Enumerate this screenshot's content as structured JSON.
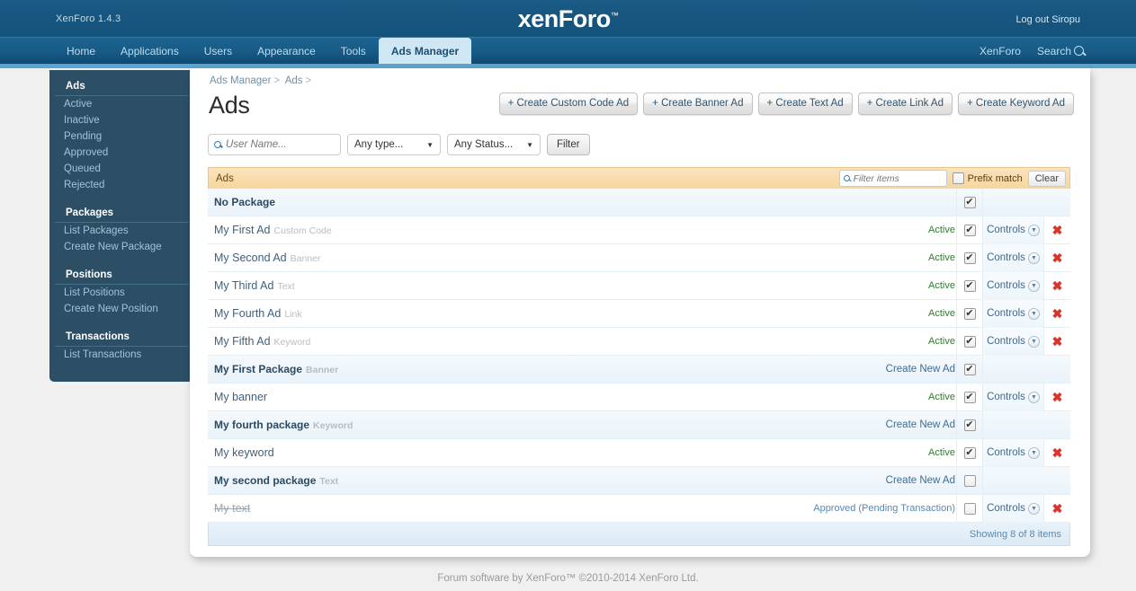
{
  "masthead": {
    "version": "XenForo 1.4.3",
    "logo": "xenForo",
    "logo_tm": "™",
    "logout": "Log out Siropu"
  },
  "nav": {
    "tabs": [
      {
        "label": "Home",
        "active": false
      },
      {
        "label": "Applications",
        "active": false
      },
      {
        "label": "Users",
        "active": false
      },
      {
        "label": "Appearance",
        "active": false
      },
      {
        "label": "Tools",
        "active": false
      },
      {
        "label": "Ads Manager",
        "active": true
      }
    ],
    "right": [
      {
        "label": "XenForo"
      },
      {
        "label": "Search"
      }
    ]
  },
  "sidebar": {
    "groups": [
      {
        "title": "Ads",
        "items": [
          "Active",
          "Inactive",
          "Pending",
          "Approved",
          "Queued",
          "Rejected"
        ]
      },
      {
        "title": "Packages",
        "items": [
          "List Packages",
          "Create New Package"
        ]
      },
      {
        "title": "Positions",
        "items": [
          "List Positions",
          "Create New Position"
        ]
      },
      {
        "title": "Transactions",
        "items": [
          "List Transactions"
        ]
      }
    ]
  },
  "breadcrumb": {
    "items": [
      "Ads Manager",
      "Ads"
    ],
    "separator": ">"
  },
  "page": {
    "title": "Ads"
  },
  "create_buttons": [
    "+ Create Custom Code Ad",
    "+ Create Banner Ad",
    "+ Create Text Ad",
    "+ Create Link Ad",
    "+ Create Keyword Ad"
  ],
  "filters": {
    "username_placeholder": "User Name...",
    "username_value": "",
    "type_selected": "Any type...",
    "status_selected": "Any Status...",
    "filter_button": "Filter"
  },
  "list": {
    "header_title": "Ads",
    "item_filter_placeholder": "Filter items",
    "item_filter_value": "",
    "prefix_match_label": "Prefix match",
    "prefix_match_checked": false,
    "clear_label": "Clear",
    "footer": "Showing 8 of 8 items",
    "controls_label": "Controls",
    "create_new_ad_label": "Create New Ad",
    "rows": [
      {
        "name": "No Package",
        "type": "",
        "kind": "package",
        "status": "",
        "status_kind": "none",
        "checked": true,
        "has_controls": false,
        "struck": false
      },
      {
        "name": "My First Ad",
        "type": "Custom Code",
        "kind": "ad",
        "status": "Active",
        "status_kind": "active",
        "checked": true,
        "has_controls": true,
        "struck": false
      },
      {
        "name": "My Second Ad",
        "type": "Banner",
        "kind": "ad",
        "status": "Active",
        "status_kind": "active",
        "checked": true,
        "has_controls": true,
        "struck": false
      },
      {
        "name": "My Third Ad",
        "type": "Text",
        "kind": "ad",
        "status": "Active",
        "status_kind": "active",
        "checked": true,
        "has_controls": true,
        "struck": false
      },
      {
        "name": "My Fourth Ad",
        "type": "Link",
        "kind": "ad",
        "status": "Active",
        "status_kind": "active",
        "checked": true,
        "has_controls": true,
        "struck": false
      },
      {
        "name": "My Fifth Ad",
        "type": "Keyword",
        "kind": "ad",
        "status": "Active",
        "status_kind": "active",
        "checked": true,
        "has_controls": true,
        "struck": false
      },
      {
        "name": "My First Package",
        "type": "Banner",
        "kind": "package",
        "status": "Create New Ad",
        "status_kind": "createnew",
        "checked": true,
        "has_controls": false,
        "struck": false
      },
      {
        "name": "My banner",
        "type": "",
        "kind": "ad",
        "status": "Active",
        "status_kind": "active",
        "checked": true,
        "has_controls": true,
        "struck": false
      },
      {
        "name": "My fourth package",
        "type": "Keyword",
        "kind": "package",
        "status": "Create New Ad",
        "status_kind": "createnew",
        "checked": true,
        "has_controls": false,
        "struck": false
      },
      {
        "name": "My keyword",
        "type": "",
        "kind": "ad",
        "status": "Active",
        "status_kind": "active",
        "checked": true,
        "has_controls": true,
        "struck": false
      },
      {
        "name": "My second package",
        "type": "Text",
        "kind": "package",
        "status": "Create New Ad",
        "status_kind": "createnew",
        "checked": false,
        "has_controls": false,
        "struck": false
      },
      {
        "name": "My text",
        "type": "",
        "kind": "ad",
        "status": "Approved (Pending Transaction)",
        "status_kind": "link",
        "checked": false,
        "has_controls": true,
        "struck": true
      }
    ]
  },
  "footer": {
    "text": "Forum software by XenForo™ ©2010-2014 XenForo Ltd."
  },
  "colors": {
    "masthead": "#17557e",
    "nav": "#175a85",
    "nav_strip": "#5ba3d0",
    "active_tab_bg": "#cfe6f5",
    "sidebar": "#2d4f66",
    "list_header": "#f7d69d",
    "status_active": "#2f7d2f",
    "status_link": "#5c87b0",
    "delete": "#d8342b"
  }
}
